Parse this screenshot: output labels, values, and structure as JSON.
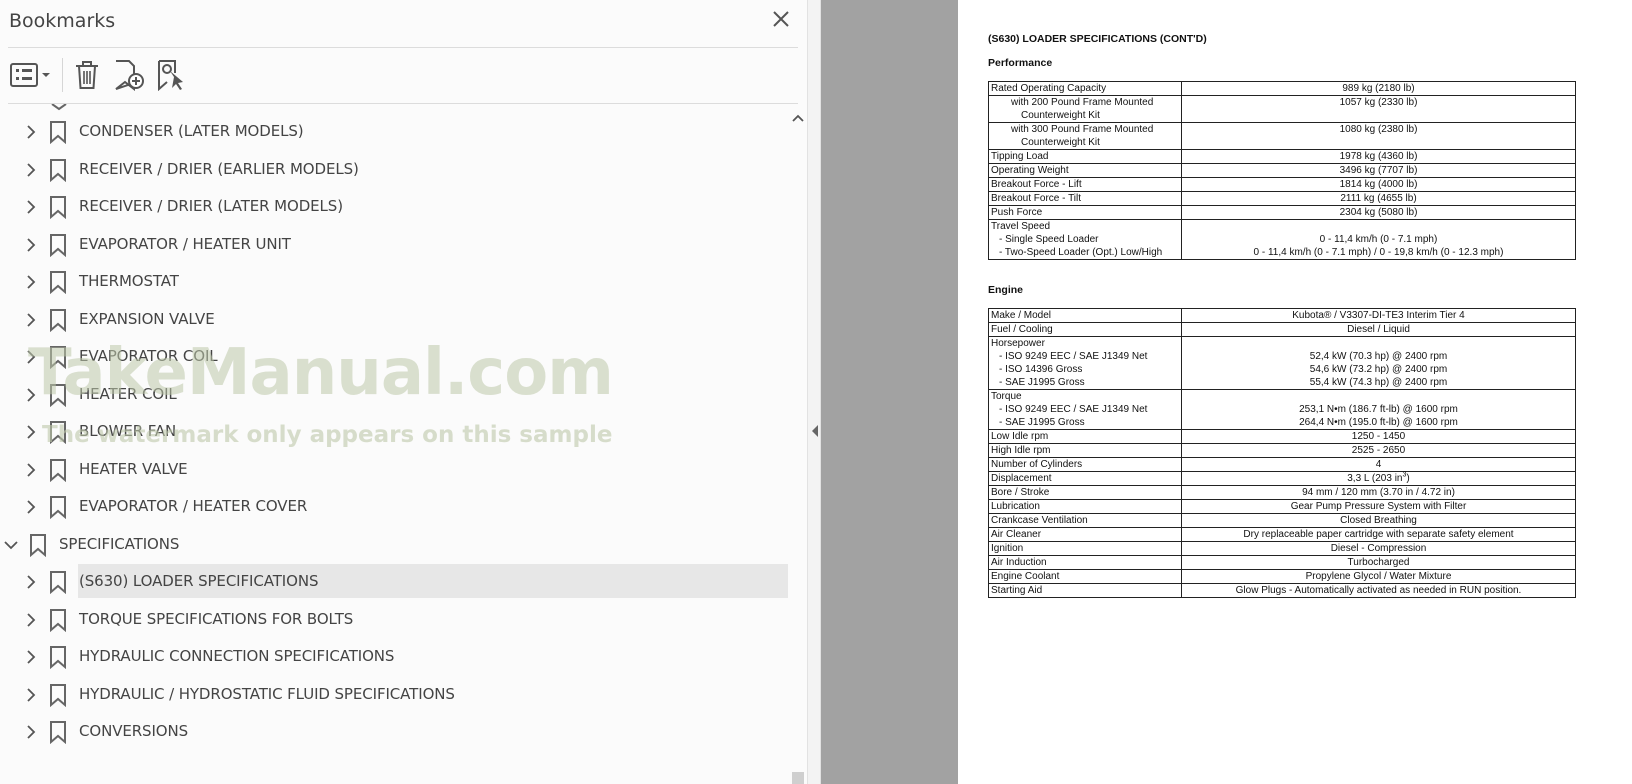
{
  "bookmarks": {
    "title": "Bookmarks",
    "items": [
      {
        "label": "CONDENSER (LATER MODELS)",
        "level": 1,
        "expanded": false
      },
      {
        "label": "RECEIVER / DRIER (EARLIER MODELS)",
        "level": 1,
        "expanded": false
      },
      {
        "label": "RECEIVER / DRIER (LATER MODELS)",
        "level": 1,
        "expanded": false
      },
      {
        "label": "EVAPORATOR / HEATER UNIT",
        "level": 1,
        "expanded": false
      },
      {
        "label": "THERMOSTAT",
        "level": 1,
        "expanded": false
      },
      {
        "label": "EXPANSION VALVE",
        "level": 1,
        "expanded": false
      },
      {
        "label": "EVAPORATOR COIL",
        "level": 1,
        "expanded": false
      },
      {
        "label": "HEATER COIL",
        "level": 1,
        "expanded": false
      },
      {
        "label": "BLOWER FAN",
        "level": 1,
        "expanded": false
      },
      {
        "label": "HEATER VALVE",
        "level": 1,
        "expanded": false
      },
      {
        "label": "EVAPORATOR / HEATER COVER",
        "level": 1,
        "expanded": false
      },
      {
        "label": "SPECIFICATIONS",
        "level": 0,
        "expanded": true
      },
      {
        "label": "(S630) LOADER SPECIFICATIONS",
        "level": 1,
        "expanded": false,
        "selected": true
      },
      {
        "label": "TORQUE SPECIFICATIONS FOR BOLTS",
        "level": 1,
        "expanded": false
      },
      {
        "label": "HYDRAULIC CONNECTION SPECIFICATIONS",
        "level": 1,
        "expanded": false
      },
      {
        "label": "HYDRAULIC / HYDROSTATIC FLUID SPECIFICATIONS",
        "level": 1,
        "expanded": false
      },
      {
        "label": "CONVERSIONS",
        "level": 1,
        "expanded": false
      }
    ]
  },
  "watermark": {
    "main": "TakeManual.com",
    "sub": "The watermark only appears on this sample"
  },
  "document": {
    "page_title": "(S630) LOADER SPECIFICATIONS (CONT'D)",
    "performance": {
      "heading": "Performance",
      "rows": [
        {
          "key": [
            "Rated Operating Capacity"
          ],
          "value": [
            "989 kg (2180 lb)"
          ]
        },
        {
          "key": [
            "with 200 Pound Frame Mounted",
            "Counterweight Kit"
          ],
          "value": [
            "1057 kg (2330 lb)"
          ],
          "indent": true
        },
        {
          "key": [
            "with 300 Pound Frame Mounted",
            "Counterweight Kit"
          ],
          "value": [
            "1080 kg (2380 lb)"
          ],
          "indent": true
        },
        {
          "key": [
            "Tipping Load"
          ],
          "value": [
            "1978 kg (4360 lb)"
          ]
        },
        {
          "key": [
            "Operating Weight"
          ],
          "value": [
            "3496 kg (7707 lb)"
          ]
        },
        {
          "key": [
            "Breakout Force - Lift"
          ],
          "value": [
            "1814 kg (4000 lb)"
          ]
        },
        {
          "key": [
            "Breakout Force - Tilt"
          ],
          "value": [
            "2111 kg (4655 lb)"
          ]
        },
        {
          "key": [
            "Push Force"
          ],
          "value": [
            "2304 kg (5080 lb)"
          ]
        },
        {
          "key": [
            "Travel Speed",
            "- Single Speed Loader",
            "- Two-Speed Loader (Opt.) Low/High"
          ],
          "value": [
            "",
            "0 - 11,4 km/h (0 - 7.1 mph)",
            "0 - 11,4 km/h (0 - 7.1 mph) / 0 - 19,8 km/h (0 - 12.3 mph)"
          ]
        }
      ]
    },
    "engine": {
      "heading": "Engine",
      "rows": [
        {
          "key": [
            "Make / Model"
          ],
          "value": [
            "Kubota® / V3307-DI-TE3 Interim Tier 4"
          ]
        },
        {
          "key": [
            "Fuel / Cooling"
          ],
          "value": [
            "Diesel / Liquid"
          ]
        },
        {
          "key": [
            "Horsepower",
            "- ISO 9249 EEC / SAE J1349 Net",
            "- ISO 14396 Gross",
            "- SAE J1995 Gross"
          ],
          "value": [
            "",
            "52,4 kW (70.3 hp) @ 2400 rpm",
            "54,6 kW (73.2 hp) @ 2400 rpm",
            "55,4 kW (74.3 hp) @ 2400 rpm"
          ]
        },
        {
          "key": [
            "Torque",
            "- ISO 9249 EEC / SAE J1349 Net",
            "- SAE J1995 Gross"
          ],
          "value": [
            "",
            "253,1 N•m (186.7 ft-lb) @ 1600 rpm",
            "264,4 N•m (195.0 ft-lb) @ 1600 rpm"
          ]
        },
        {
          "key": [
            "Low Idle rpm"
          ],
          "value": [
            "1250 - 1450"
          ]
        },
        {
          "key": [
            "High Idle rpm"
          ],
          "value": [
            "2525 - 2650"
          ]
        },
        {
          "key": [
            "Number of Cylinders"
          ],
          "value": [
            "4"
          ]
        },
        {
          "key": [
            "Displacement"
          ],
          "value": [
            "3,3 L (203 in"
          ],
          "sup": "3",
          "suffix": ")"
        },
        {
          "key": [
            "Bore / Stroke"
          ],
          "value": [
            "94 mm / 120 mm (3.70 in / 4.72 in)"
          ]
        },
        {
          "key": [
            "Lubrication"
          ],
          "value": [
            "Gear Pump Pressure System with Filter"
          ]
        },
        {
          "key": [
            "Crankcase Ventilation"
          ],
          "value": [
            "Closed Breathing"
          ]
        },
        {
          "key": [
            "Air Cleaner"
          ],
          "value": [
            "Dry replaceable paper cartridge with separate safety element"
          ]
        },
        {
          "key": [
            "Ignition"
          ],
          "value": [
            "Diesel - Compression"
          ]
        },
        {
          "key": [
            "Air Induction"
          ],
          "value": [
            "Turbocharged"
          ]
        },
        {
          "key": [
            "Engine Coolant"
          ],
          "value": [
            "Propylene Glycol / Water Mixture"
          ]
        },
        {
          "key": [
            "Starting Aid"
          ],
          "value": [
            "Glow Plugs - Automatically activated as needed in RUN position."
          ]
        }
      ]
    }
  },
  "icons": {
    "close": "close-icon",
    "options": "list-options-icon",
    "delete": "trash-icon",
    "add": "add-bookmark-icon",
    "find": "find-bookmark-icon",
    "bookmark": "bookmark-icon",
    "chevron_right": "chevron-right-icon",
    "chevron_down": "chevron-down-icon"
  }
}
